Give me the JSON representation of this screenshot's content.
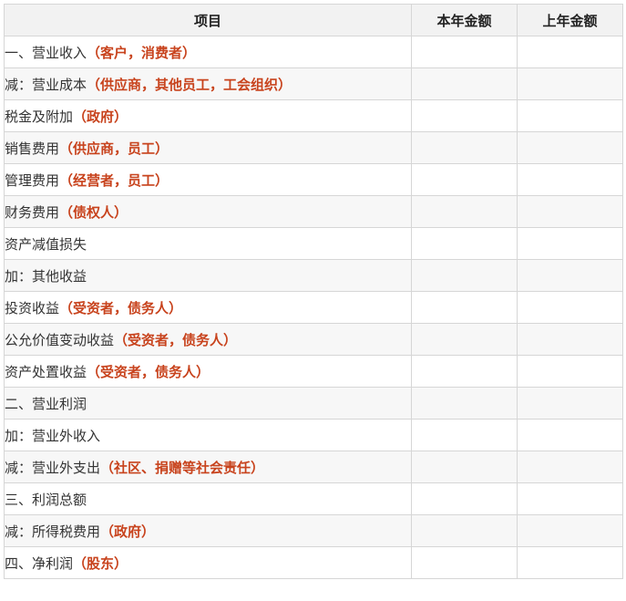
{
  "table": {
    "headers": [
      "项目",
      "本年金额",
      "上年金额"
    ],
    "rows": [
      {
        "label": "一、营业收入",
        "note": "（客户，消费者）",
        "level": 0
      },
      {
        "label": "减：营业成本",
        "note": "（供应商，其他员工，工会组织）",
        "level": 1
      },
      {
        "label": "税金及附加",
        "note": "（政府）",
        "level": 2
      },
      {
        "label": "销售费用",
        "note": "（供应商，员工）",
        "level": 2
      },
      {
        "label": "管理费用",
        "note": "（经营者，员工）",
        "level": 2
      },
      {
        "label": "财务费用",
        "note": "（债权人）",
        "level": 2
      },
      {
        "label": "资产减值损失",
        "note": "",
        "level": 2
      },
      {
        "label": "加：其他收益",
        "note": "",
        "level": 1
      },
      {
        "label": "投资收益",
        "note": "（受资者，债务人）",
        "level": 2
      },
      {
        "label": "公允价值变动收益",
        "note": "（受资者，债务人）",
        "level": 2
      },
      {
        "label": "资产处置收益",
        "note": "（受资者，债务人）",
        "level": 2
      },
      {
        "label": "二、营业利润",
        "note": "",
        "level": 0
      },
      {
        "label": "加：营业外收入",
        "note": "",
        "level": 1
      },
      {
        "label": "减：营业外支出",
        "note": "（社区、捐赠等社会责任）",
        "level": 1
      },
      {
        "label": "三、利润总额",
        "note": "",
        "level": 0
      },
      {
        "label": "减：所得税费用",
        "note": "（政府）",
        "level": 1
      },
      {
        "label": "四、净利润",
        "note": "（股东）",
        "level": 0
      }
    ],
    "current_year": [
      "",
      "",
      "",
      "",
      "",
      "",
      "",
      "",
      "",
      "",
      "",
      "",
      "",
      "",
      "",
      "",
      ""
    ],
    "prior_year": [
      "",
      "",
      "",
      "",
      "",
      "",
      "",
      "",
      "",
      "",
      "",
      "",
      "",
      "",
      "",
      "",
      ""
    ]
  }
}
